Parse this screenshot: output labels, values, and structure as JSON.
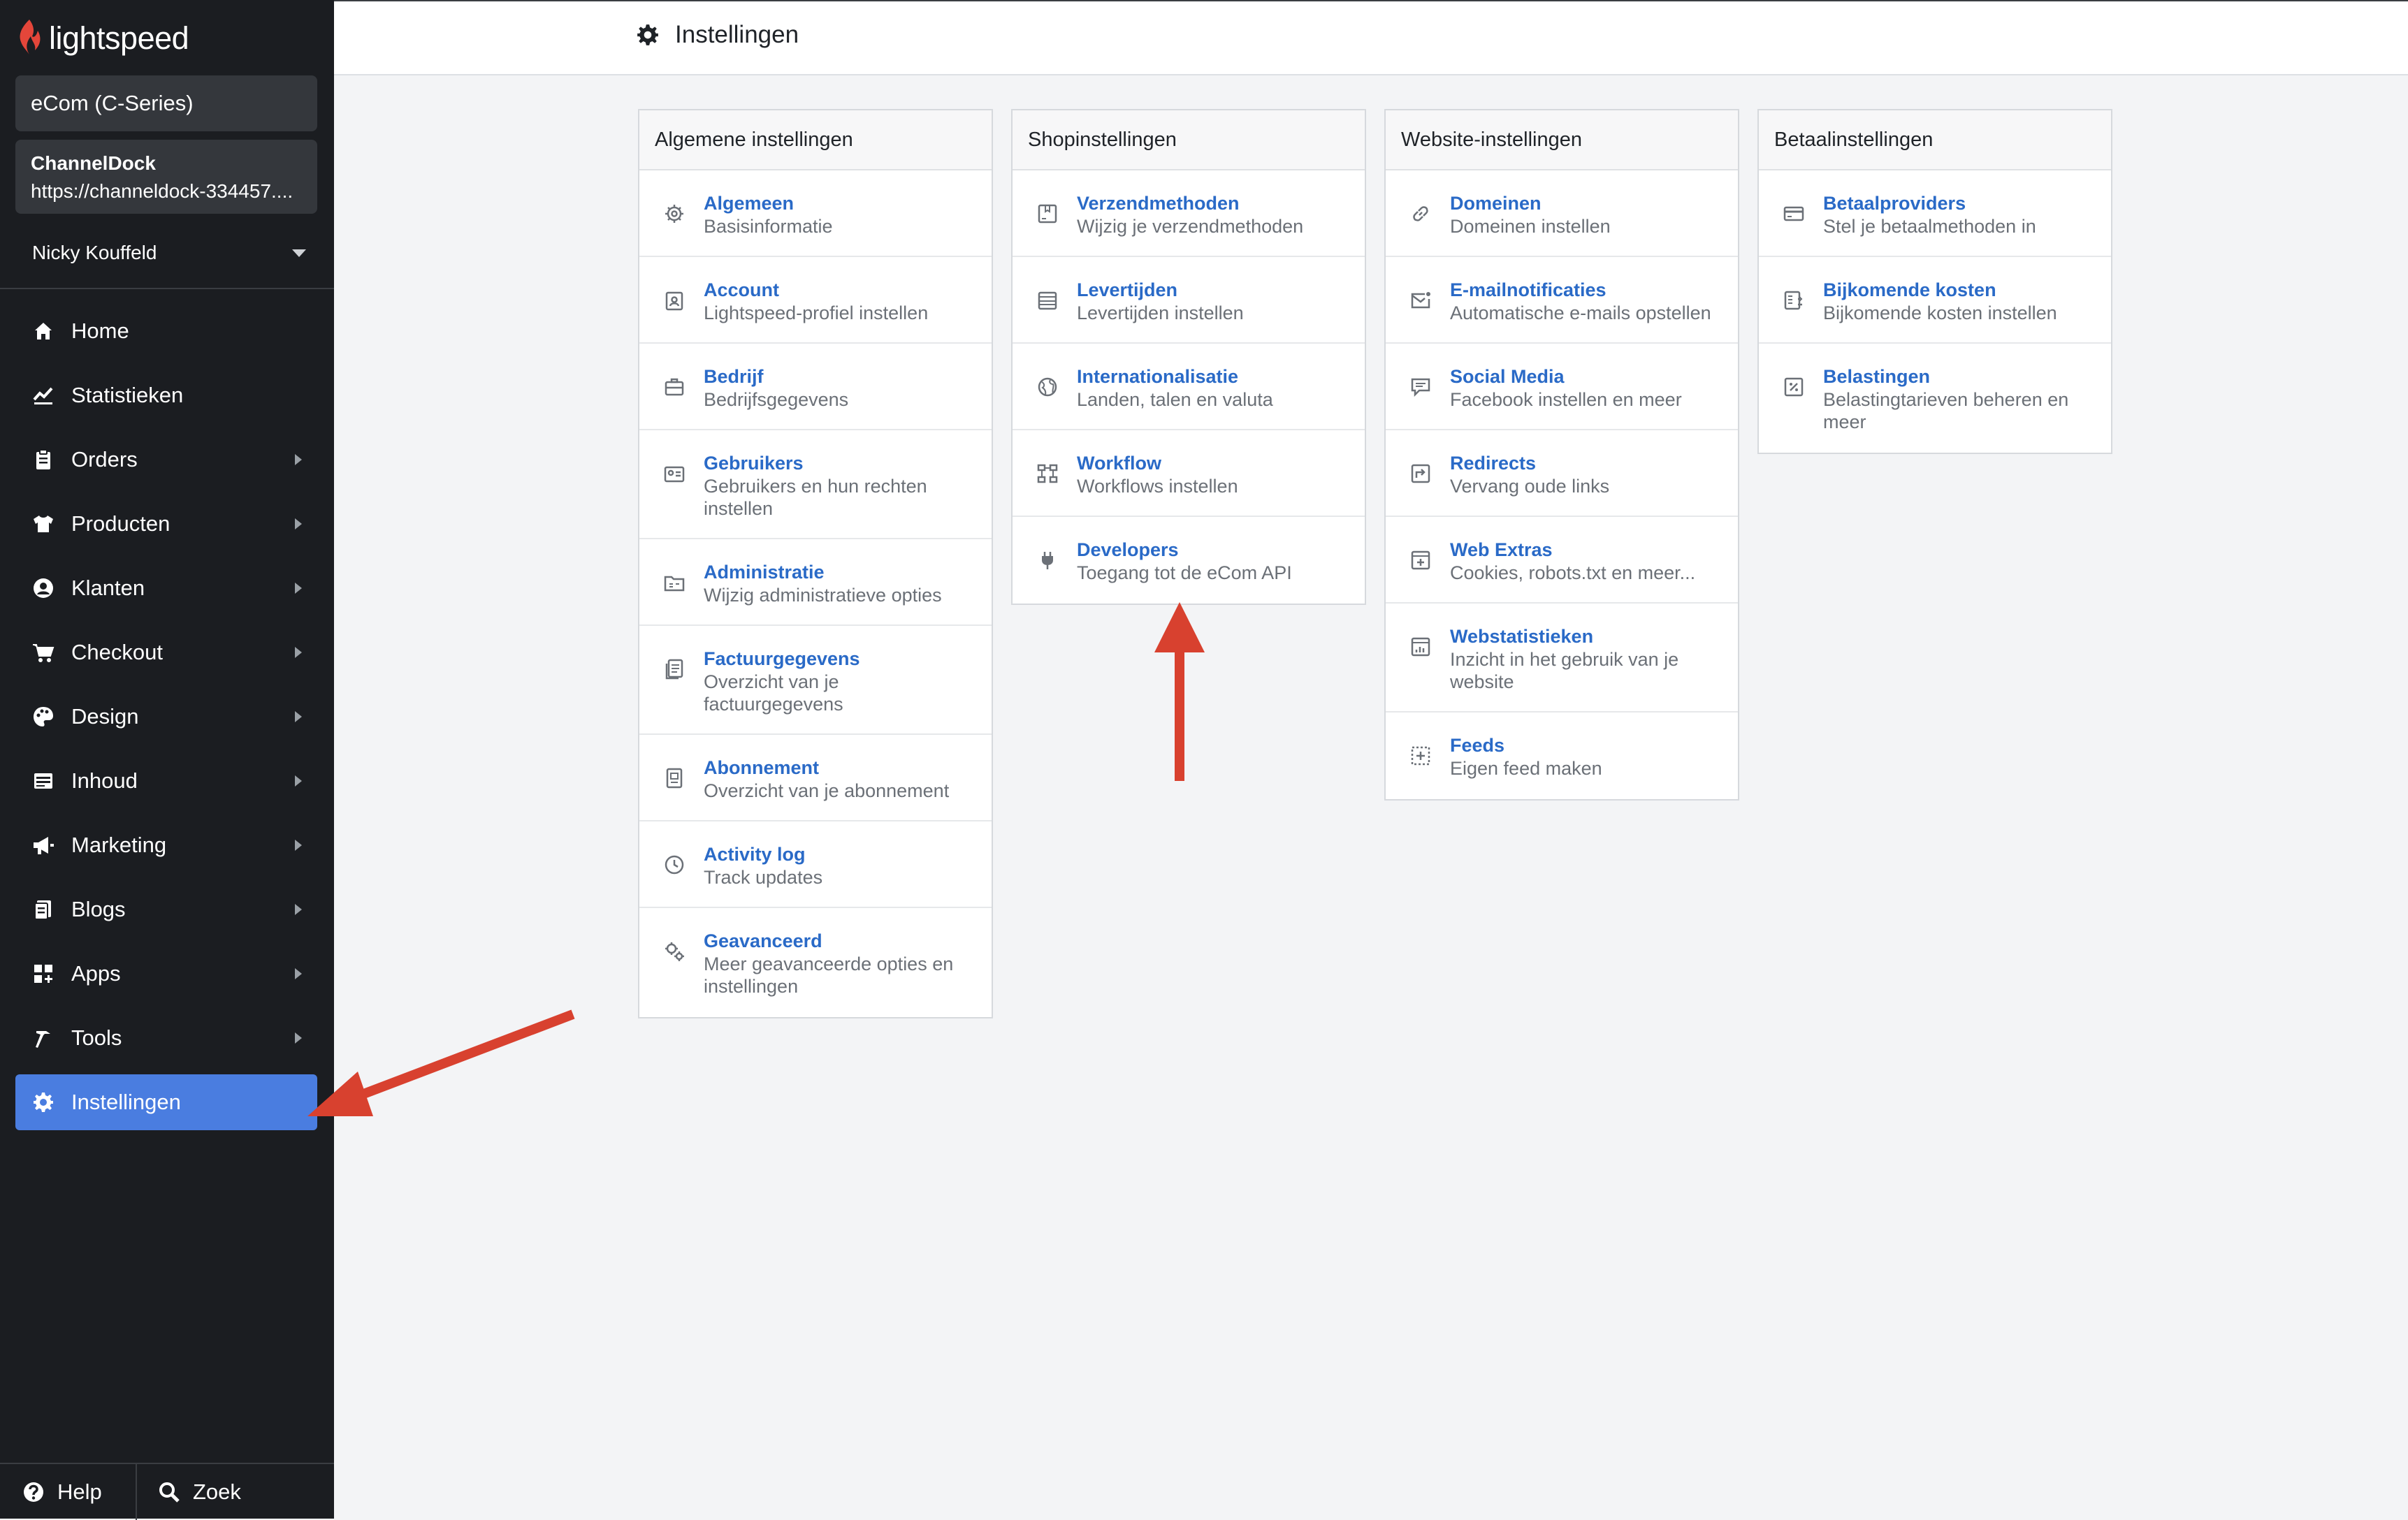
{
  "brand": {
    "name": "lightspeed"
  },
  "sidebar": {
    "shop_type": "eCom (C-Series)",
    "shop_name": "ChannelDock",
    "shop_url": "https://channeldock-334457....",
    "user": "Nicky Kouffeld",
    "items": [
      {
        "label": "Home",
        "icon": "home-icon"
      },
      {
        "label": "Statistieken",
        "icon": "chart-icon"
      },
      {
        "label": "Orders",
        "icon": "clipboard-icon"
      },
      {
        "label": "Producten",
        "icon": "shirt-icon"
      },
      {
        "label": "Klanten",
        "icon": "user-circle-icon"
      },
      {
        "label": "Checkout",
        "icon": "cart-icon"
      },
      {
        "label": "Design",
        "icon": "palette-icon"
      },
      {
        "label": "Inhoud",
        "icon": "content-icon"
      },
      {
        "label": "Marketing",
        "icon": "megaphone-icon"
      },
      {
        "label": "Blogs",
        "icon": "blog-icon"
      },
      {
        "label": "Apps",
        "icon": "apps-icon"
      },
      {
        "label": "Tools",
        "icon": "hammer-icon"
      },
      {
        "label": "Instellingen",
        "icon": "gear-icon"
      }
    ],
    "help_label": "Help",
    "search_label": "Zoek"
  },
  "header": {
    "title": "Instellingen"
  },
  "cards": [
    {
      "title": "Algemene instellingen",
      "items": [
        {
          "title": "Algemeen",
          "desc1": "Basisinformatie",
          "desc2": ""
        },
        {
          "title": "Account",
          "desc1": "Lightspeed-profiel instellen",
          "desc2": ""
        },
        {
          "title": "Bedrijf",
          "desc1": "Bedrijfsgegevens",
          "desc2": ""
        },
        {
          "title": "Gebruikers",
          "desc1": "Gebruikers en hun rechten",
          "desc2": "instellen"
        },
        {
          "title": "Administratie",
          "desc1": "Wijzig administratieve opties",
          "desc2": ""
        },
        {
          "title": "Factuurgegevens",
          "desc1": "Overzicht van je",
          "desc2": "factuurgegevens"
        },
        {
          "title": "Abonnement",
          "desc1": "Overzicht van je abonnement",
          "desc2": ""
        },
        {
          "title": "Activity log",
          "desc1": "Track updates",
          "desc2": ""
        },
        {
          "title": "Geavanceerd",
          "desc1": "Meer geavanceerde opties en",
          "desc2": "instellingen"
        }
      ]
    },
    {
      "title": "Shopinstellingen",
      "items": [
        {
          "title": "Verzendmethoden",
          "desc1": "Wijzig je verzendmethoden",
          "desc2": ""
        },
        {
          "title": "Levertijden",
          "desc1": "Levertijden instellen",
          "desc2": ""
        },
        {
          "title": "Internationalisatie",
          "desc1": "Landen, talen en valuta",
          "desc2": ""
        },
        {
          "title": "Workflow",
          "desc1": "Workflows instellen",
          "desc2": ""
        },
        {
          "title": "Developers",
          "desc1": "Toegang tot de eCom API",
          "desc2": ""
        }
      ]
    },
    {
      "title": "Website-instellingen",
      "items": [
        {
          "title": "Domeinen",
          "desc1": "Domeinen instellen",
          "desc2": ""
        },
        {
          "title": "E-mailnotificaties",
          "desc1": "Automatische e-mails opstellen",
          "desc2": ""
        },
        {
          "title": "Social Media",
          "desc1": "Facebook instellen en meer",
          "desc2": ""
        },
        {
          "title": "Redirects",
          "desc1": "Vervang oude links",
          "desc2": ""
        },
        {
          "title": "Web Extras",
          "desc1": "Cookies, robots.txt en meer...",
          "desc2": ""
        },
        {
          "title": "Webstatistieken",
          "desc1": "Inzicht in het gebruik van je",
          "desc2": "website"
        },
        {
          "title": "Feeds",
          "desc1": "Eigen feed maken",
          "desc2": ""
        }
      ]
    },
    {
      "title": "Betaalinstellingen",
      "items": [
        {
          "title": "Betaalproviders",
          "desc1": "Stel je betaalmethoden in",
          "desc2": ""
        },
        {
          "title": "Bijkomende kosten",
          "desc1": "Bijkomende kosten instellen",
          "desc2": ""
        },
        {
          "title": "Belastingen",
          "desc1": "Belastingtarieven beheren en",
          "desc2": "meer"
        }
      ]
    }
  ],
  "colors": {
    "sidebar_bg": "#1b1d21",
    "active": "#4a7de0",
    "link": "#2a6ac7",
    "annotation": "#d8412f"
  }
}
